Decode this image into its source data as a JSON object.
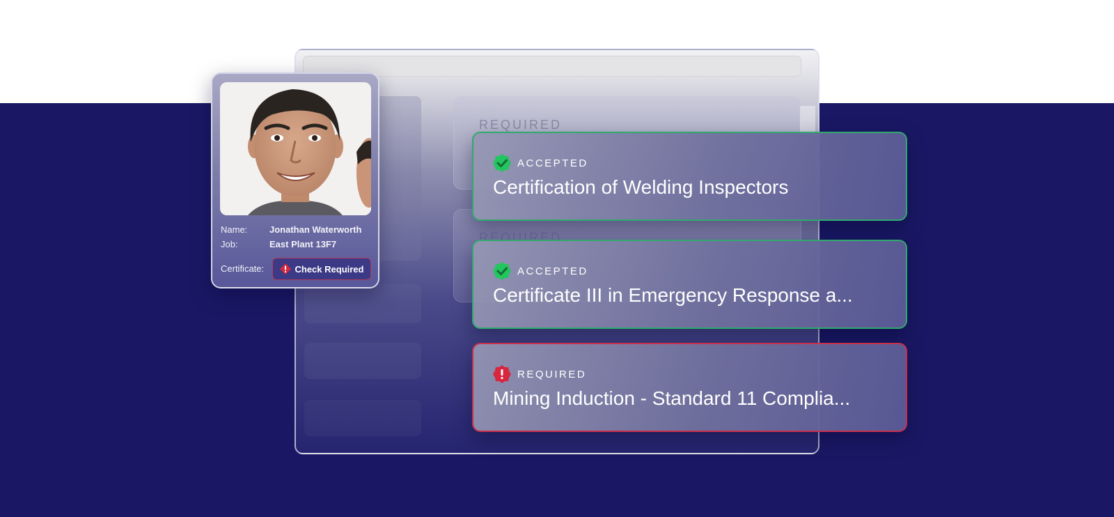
{
  "colors": {
    "navy_background": "#1a1864",
    "accepted_green": "#22c55e",
    "required_red": "#d7263d"
  },
  "background_window": {
    "panels": [
      {
        "label": "REQUIRED"
      },
      {
        "label": "REQUIRED"
      }
    ]
  },
  "profile": {
    "name_label": "Name:",
    "name_value": "Jonathan Waterworth",
    "job_label": "Job:",
    "job_value": "East Plant 13F7",
    "certificate_label": "Certificate:",
    "check_button_label": "Check Required",
    "check_button_icon": "required-warning-icon"
  },
  "certificates": [
    {
      "status": "ACCEPTED",
      "icon": "check-badge-icon",
      "title": "Certification of Welding Inspectors"
    },
    {
      "status": "ACCEPTED",
      "icon": "check-badge-icon",
      "title": "Certificate III in Emergency Response a..."
    },
    {
      "status": "REQUIRED",
      "icon": "warning-badge-icon",
      "title": "Mining Induction - Standard 11 Complia..."
    }
  ]
}
